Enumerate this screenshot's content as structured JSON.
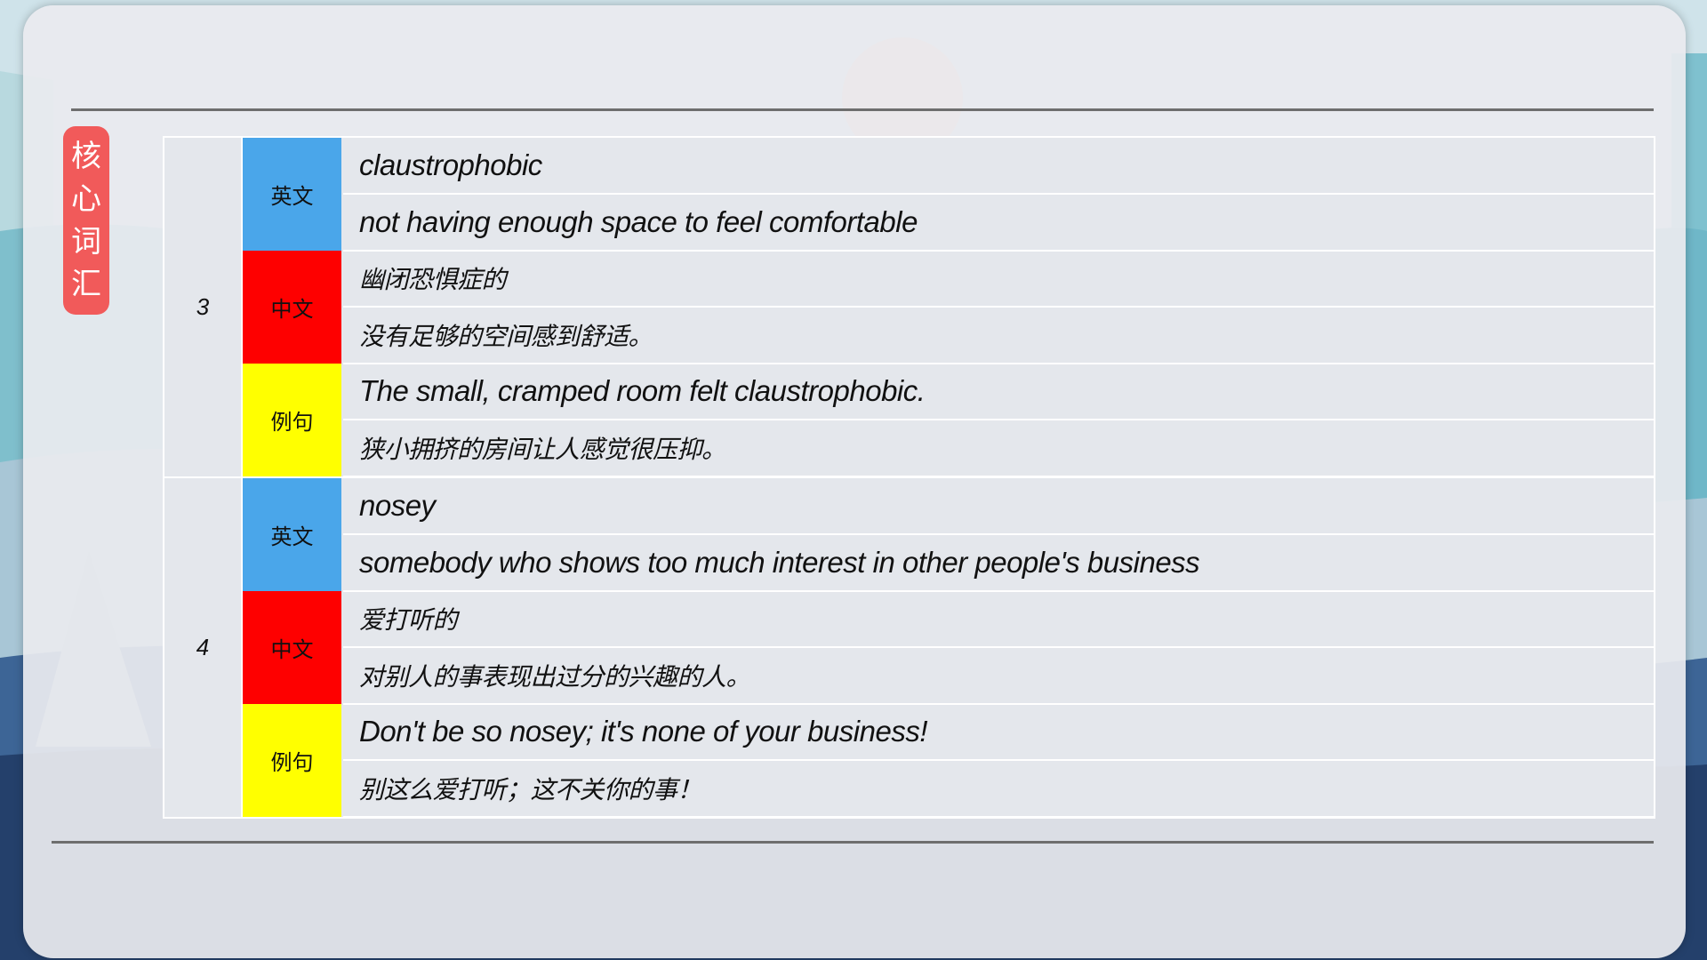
{
  "section_label": [
    "核",
    "心",
    "词",
    "汇"
  ],
  "tags": {
    "english": "英文",
    "chinese": "中文",
    "example": "例句"
  },
  "entries": [
    {
      "number": "3",
      "word": "claustrophobic",
      "definition_en": "not having enough space to feel comfortable",
      "word_zh": "幽闭恐惧症的",
      "definition_zh": "没有足够的空间感到舒适。",
      "example_en": "The small, cramped room felt claustrophobic.",
      "example_zh": "狭小拥挤的房间让人感觉很压抑。"
    },
    {
      "number": "4",
      "word": "nosey",
      "definition_en": "somebody who shows too much interest in other people's business",
      "word_zh": "爱打听的",
      "definition_zh": "对别人的事表现出过分的兴趣的人。",
      "example_en": "Don't be so nosey; it's none of your business!",
      "example_zh": "别这么爱打听；这不关你的事！"
    }
  ],
  "colors": {
    "english_tag": "#4aa6ea",
    "chinese_tag": "#fe0000",
    "example_tag": "#ffff00",
    "badge": "#f15a5a"
  }
}
